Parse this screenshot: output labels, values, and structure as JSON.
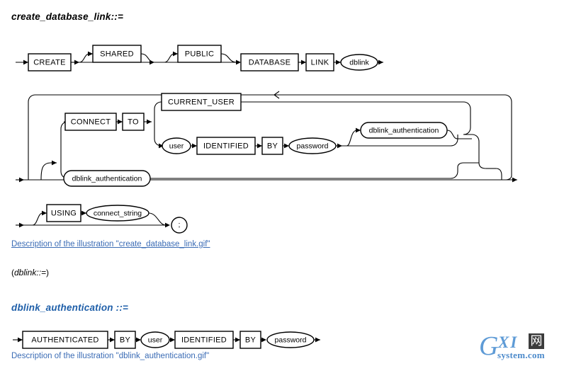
{
  "page": {
    "background": "#ffffff",
    "link_color": "#3B6CB5",
    "heading_blue": "#1F5FA9",
    "line_color": "#000000"
  },
  "sections": {
    "create_database_link": {
      "heading": "create_database_link::=",
      "caption": "Description of the illustration \"create_database_link.gif\"",
      "caption_underlined": true
    },
    "dblink_note": {
      "text_open": "(",
      "text_italic": "dblink::=",
      "text_close": ")"
    },
    "dblink_authentication": {
      "heading": "dblink_authentication ::=",
      "caption": "Description of the illustration \"dblink_authentication.gif\"",
      "caption_underlined": false
    }
  },
  "railroad": {
    "row1_labels": {
      "create": "CREATE",
      "shared": "SHARED",
      "public": "PUBLIC",
      "database": "DATABASE",
      "link": "LINK",
      "dblink": "dblink"
    },
    "row2_labels": {
      "connect": "CONNECT",
      "to": "TO",
      "current_user": "CURRENT_USER",
      "user": "user",
      "identified": "IDENTIFIED",
      "by": "BY",
      "password": "password",
      "dblink_authentication_inner": "dblink_authentication",
      "dblink_authentication_alt": "dblink_authentication"
    },
    "row3_labels": {
      "using": "USING",
      "connect_string": "connect_string",
      "semicolon": ";"
    },
    "row4_labels": {
      "authenticated": "AUTHENTICATED",
      "by1": "BY",
      "user": "user",
      "identified": "IDENTIFIED",
      "by2": "BY",
      "password": "password"
    }
  },
  "watermark": {
    "letter_g": "G",
    "letters_xi": "XI",
    "char_cn": "网",
    "domain": "system.com"
  }
}
